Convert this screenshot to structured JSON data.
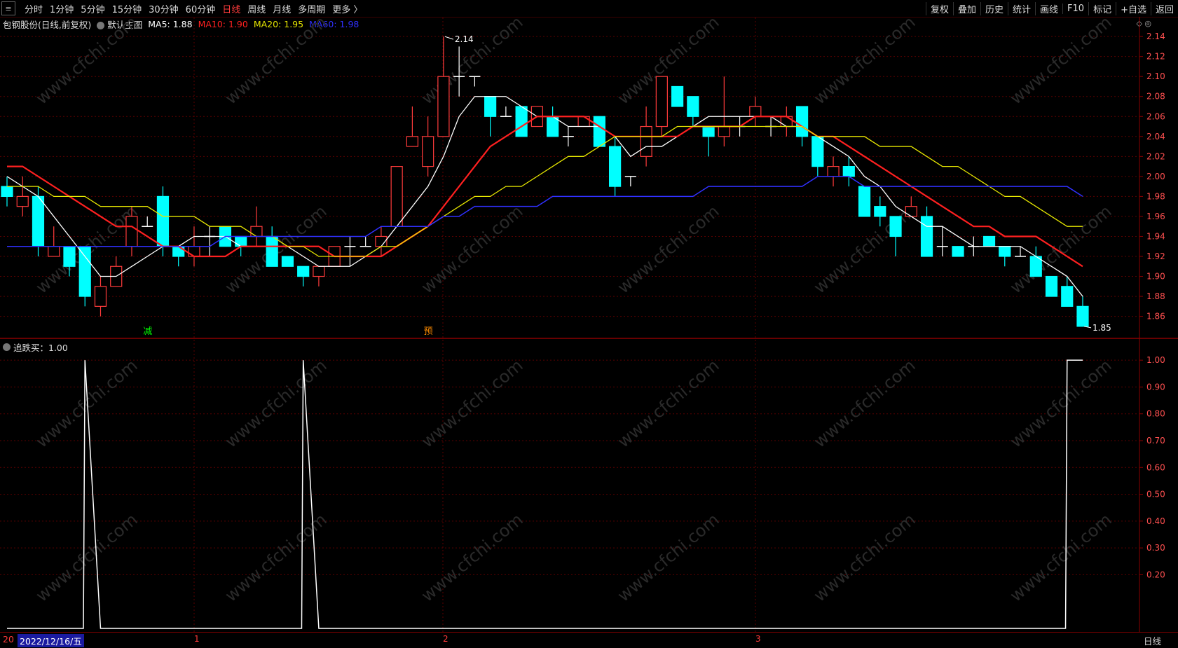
{
  "toolbar": {
    "periods": [
      "分时",
      "1分钟",
      "5分钟",
      "15分钟",
      "30分钟",
      "60分钟",
      "日线",
      "周线",
      "月线",
      "多周期",
      "更多 〉"
    ],
    "active_period": "日线",
    "right_buttons": [
      "复权",
      "叠加",
      "历史",
      "统计",
      "画线",
      "F10",
      "标记",
      "+自选",
      "返回"
    ]
  },
  "main_legend": {
    "stock": "包钢股份(日线,前复权)",
    "template": "默认主图",
    "ma5": "MA5: 1.88",
    "ma10": "MA10: 1.90",
    "ma20": "MA20: 1.95",
    "ma60": "MA60: 1.98"
  },
  "indicator_legend": "追跌买：1.00",
  "bottom": {
    "date": "2022/12/16/五",
    "prefix": "20",
    "period_label": "日线",
    "month_marks": [
      "1",
      "2",
      "3"
    ]
  },
  "annotations": {
    "high_label": "2.14",
    "low_label": "1.85",
    "signal_jian": "减",
    "signal_yu": "预"
  },
  "watermark": "www.cfchi.com",
  "colors": {
    "up": "#ff3b3b",
    "down": "#00ffff",
    "ma5": "#ffffff",
    "ma10": "#ff2020",
    "ma20": "#e6e600",
    "ma60": "#3030ff",
    "grid": "#5a0000"
  },
  "chart_data": [
    {
      "type": "candlestick",
      "title": "包钢股份(日线,前复权)",
      "ylim": [
        1.845,
        2.145
      ],
      "y_ticks": [
        "2.14",
        "2.12",
        "2.10",
        "2.08",
        "2.06",
        "2.04",
        "2.02",
        "2.00",
        "1.98",
        "1.96",
        "1.94",
        "1.92",
        "1.90",
        "1.88",
        "1.86"
      ],
      "candles": [
        [
          1.99,
          1.98,
          2.0,
          1.97
        ],
        [
          1.97,
          1.98,
          2.0,
          1.96
        ],
        [
          1.98,
          1.93,
          1.99,
          1.92
        ],
        [
          1.92,
          1.93,
          1.95,
          1.92
        ],
        [
          1.93,
          1.91,
          1.93,
          1.9
        ],
        [
          1.93,
          1.88,
          1.93,
          1.87
        ],
        [
          1.87,
          1.89,
          1.9,
          1.86
        ],
        [
          1.89,
          1.91,
          1.92,
          1.89
        ],
        [
          1.93,
          1.96,
          1.97,
          1.92
        ],
        [
          1.95,
          1.95,
          1.96,
          1.95
        ],
        [
          1.98,
          1.93,
          1.99,
          1.92
        ],
        [
          1.93,
          1.92,
          1.93,
          1.91
        ],
        [
          1.92,
          1.93,
          1.95,
          1.91
        ],
        [
          1.94,
          1.94,
          1.95,
          1.92
        ],
        [
          1.95,
          1.93,
          1.95,
          1.93
        ],
        [
          1.94,
          1.93,
          1.94,
          1.92
        ],
        [
          1.94,
          1.95,
          1.97,
          1.93
        ],
        [
          1.94,
          1.91,
          1.95,
          1.91
        ],
        [
          1.92,
          1.91,
          1.92,
          1.91
        ],
        [
          1.91,
          1.9,
          1.91,
          1.89
        ],
        [
          1.9,
          1.91,
          1.91,
          1.89
        ],
        [
          1.91,
          1.93,
          1.93,
          1.91
        ],
        [
          1.93,
          1.93,
          1.94,
          1.91
        ],
        [
          1.93,
          1.93,
          1.94,
          1.93
        ],
        [
          1.93,
          1.94,
          1.95,
          1.92
        ],
        [
          1.95,
          2.01,
          2.01,
          1.95
        ],
        [
          2.03,
          2.04,
          2.07,
          2.03
        ],
        [
          2.01,
          2.04,
          2.06,
          2.0
        ],
        [
          2.04,
          2.1,
          2.14,
          2.04
        ],
        [
          2.1,
          2.1,
          2.13,
          2.08
        ],
        [
          2.1,
          2.1,
          2.1,
          2.09
        ],
        [
          2.08,
          2.06,
          2.08,
          2.04
        ],
        [
          2.06,
          2.06,
          2.07,
          2.06
        ],
        [
          2.07,
          2.04,
          2.07,
          2.04
        ],
        [
          2.05,
          2.07,
          2.07,
          2.05
        ],
        [
          2.06,
          2.04,
          2.07,
          2.04
        ],
        [
          2.04,
          2.04,
          2.05,
          2.03
        ],
        [
          2.05,
          2.06,
          2.06,
          2.05
        ],
        [
          2.06,
          2.03,
          2.06,
          2.03
        ],
        [
          2.03,
          1.99,
          2.04,
          1.98
        ],
        [
          2.0,
          2.0,
          2.0,
          1.99
        ],
        [
          2.02,
          2.05,
          2.07,
          2.01
        ],
        [
          2.05,
          2.1,
          2.1,
          2.04
        ],
        [
          2.09,
          2.07,
          2.09,
          2.07
        ],
        [
          2.08,
          2.06,
          2.08,
          2.05
        ],
        [
          2.05,
          2.04,
          2.05,
          2.02
        ],
        [
          2.04,
          2.05,
          2.1,
          2.03
        ],
        [
          2.05,
          2.05,
          2.06,
          2.04
        ],
        [
          2.06,
          2.07,
          2.08,
          2.05
        ],
        [
          2.05,
          2.05,
          2.06,
          2.04
        ],
        [
          2.05,
          2.06,
          2.07,
          2.04
        ],
        [
          2.07,
          2.04,
          2.07,
          2.03
        ],
        [
          2.04,
          2.01,
          2.04,
          2.0
        ],
        [
          2.0,
          2.01,
          2.02,
          1.99
        ],
        [
          2.01,
          2.0,
          2.02,
          1.99
        ],
        [
          1.99,
          1.96,
          1.99,
          1.96
        ],
        [
          1.97,
          1.96,
          1.98,
          1.95
        ],
        [
          1.96,
          1.94,
          1.96,
          1.92
        ],
        [
          1.96,
          1.97,
          1.98,
          1.96
        ],
        [
          1.96,
          1.92,
          1.97,
          1.92
        ],
        [
          1.93,
          1.93,
          1.95,
          1.92
        ],
        [
          1.93,
          1.92,
          1.93,
          1.92
        ],
        [
          1.93,
          1.93,
          1.94,
          1.92
        ],
        [
          1.94,
          1.93,
          1.94,
          1.93
        ],
        [
          1.93,
          1.92,
          1.93,
          1.91
        ],
        [
          1.92,
          1.92,
          1.93,
          1.92
        ],
        [
          1.92,
          1.9,
          1.93,
          1.9
        ],
        [
          1.9,
          1.88,
          1.9,
          1.88
        ],
        [
          1.89,
          1.87,
          1.9,
          1.87
        ],
        [
          1.87,
          1.85,
          1.88,
          1.85
        ]
      ],
      "candle_order": [
        "open",
        "close",
        "high",
        "low"
      ],
      "series": [
        {
          "name": "MA5",
          "values": [
            2.0,
            1.99,
            1.98,
            1.96,
            1.94,
            1.92,
            1.9,
            1.9,
            1.91,
            1.92,
            1.93,
            1.93,
            1.94,
            1.94,
            1.94,
            1.93,
            1.93,
            1.93,
            1.93,
            1.92,
            1.91,
            1.91,
            1.91,
            1.92,
            1.93,
            1.95,
            1.97,
            1.99,
            2.02,
            2.06,
            2.08,
            2.08,
            2.08,
            2.07,
            2.06,
            2.06,
            2.05,
            2.05,
            2.05,
            2.04,
            2.02,
            2.03,
            2.03,
            2.04,
            2.05,
            2.06,
            2.06,
            2.06,
            2.06,
            2.06,
            2.05,
            2.05,
            2.04,
            2.03,
            2.02,
            2.0,
            1.99,
            1.97,
            1.96,
            1.95,
            1.95,
            1.94,
            1.93,
            1.93,
            1.93,
            1.93,
            1.92,
            1.91,
            1.9,
            1.88
          ]
        },
        {
          "name": "MA10",
          "values": [
            2.01,
            2.01,
            2.0,
            1.99,
            1.98,
            1.97,
            1.96,
            1.95,
            1.95,
            1.94,
            1.93,
            1.93,
            1.92,
            1.92,
            1.92,
            1.93,
            1.93,
            1.93,
            1.93,
            1.93,
            1.93,
            1.92,
            1.92,
            1.92,
            1.92,
            1.93,
            1.94,
            1.95,
            1.97,
            1.99,
            2.01,
            2.03,
            2.04,
            2.05,
            2.06,
            2.06,
            2.06,
            2.06,
            2.05,
            2.04,
            2.04,
            2.04,
            2.04,
            2.04,
            2.05,
            2.05,
            2.05,
            2.05,
            2.06,
            2.06,
            2.06,
            2.05,
            2.04,
            2.04,
            2.03,
            2.02,
            2.01,
            2.0,
            1.99,
            1.98,
            1.97,
            1.96,
            1.95,
            1.95,
            1.94,
            1.94,
            1.94,
            1.93,
            1.92,
            1.91
          ]
        },
        {
          "name": "MA20",
          "values": [
            1.99,
            1.99,
            1.99,
            1.98,
            1.98,
            1.98,
            1.97,
            1.97,
            1.97,
            1.97,
            1.96,
            1.96,
            1.96,
            1.95,
            1.95,
            1.95,
            1.94,
            1.94,
            1.93,
            1.93,
            1.92,
            1.92,
            1.92,
            1.92,
            1.93,
            1.93,
            1.94,
            1.95,
            1.96,
            1.97,
            1.98,
            1.98,
            1.99,
            1.99,
            2.0,
            2.01,
            2.02,
            2.02,
            2.03,
            2.04,
            2.04,
            2.04,
            2.04,
            2.05,
            2.05,
            2.05,
            2.05,
            2.05,
            2.05,
            2.05,
            2.05,
            2.05,
            2.04,
            2.04,
            2.04,
            2.04,
            2.03,
            2.03,
            2.03,
            2.02,
            2.01,
            2.01,
            2.0,
            1.99,
            1.98,
            1.98,
            1.97,
            1.96,
            1.95,
            1.95
          ]
        },
        {
          "name": "MA60",
          "values": [
            1.93,
            1.93,
            1.93,
            1.93,
            1.93,
            1.93,
            1.93,
            1.93,
            1.93,
            1.93,
            1.93,
            1.93,
            1.93,
            1.93,
            1.94,
            1.94,
            1.94,
            1.94,
            1.94,
            1.94,
            1.94,
            1.94,
            1.94,
            1.94,
            1.95,
            1.95,
            1.95,
            1.95,
            1.96,
            1.96,
            1.97,
            1.97,
            1.97,
            1.97,
            1.97,
            1.98,
            1.98,
            1.98,
            1.98,
            1.98,
            1.98,
            1.98,
            1.98,
            1.98,
            1.98,
            1.99,
            1.99,
            1.99,
            1.99,
            1.99,
            1.99,
            1.99,
            2.0,
            2.0,
            2.0,
            1.99,
            1.99,
            1.99,
            1.99,
            1.99,
            1.99,
            1.99,
            1.99,
            1.99,
            1.99,
            1.99,
            1.99,
            1.99,
            1.99,
            1.98
          ]
        }
      ],
      "high_label": {
        "index": 28,
        "value": 2.14
      },
      "low_label": {
        "index": 69,
        "value": 1.85
      },
      "signals": [
        {
          "index": 9,
          "text": "减",
          "color": "#00ff00"
        },
        {
          "index": 27,
          "text": "预",
          "color": "#ff8c00"
        }
      ]
    },
    {
      "type": "line",
      "title": "追跌买",
      "ylim": [
        0,
        1.05
      ],
      "y_ticks": [
        "1.00",
        "0.90",
        "0.80",
        "0.70",
        "0.60",
        "0.50",
        "0.40",
        "0.30",
        "0.20"
      ],
      "series": [
        {
          "name": "追跌买",
          "values": [
            0,
            0,
            0,
            0,
            0,
            1,
            0,
            0,
            0,
            0,
            0,
            0,
            0,
            0,
            0,
            0,
            0,
            0,
            0,
            1,
            0,
            0,
            0,
            0,
            0,
            0,
            0,
            0,
            0,
            0,
            0,
            0,
            0,
            0,
            0,
            0,
            0,
            0,
            0,
            0,
            0,
            0,
            0,
            0,
            0,
            0,
            0,
            0,
            0,
            0,
            0,
            0,
            0,
            0,
            0,
            0,
            0,
            0,
            0,
            0,
            0,
            0,
            0,
            0,
            0,
            0,
            0,
            0,
            1,
            1
          ]
        }
      ]
    }
  ]
}
